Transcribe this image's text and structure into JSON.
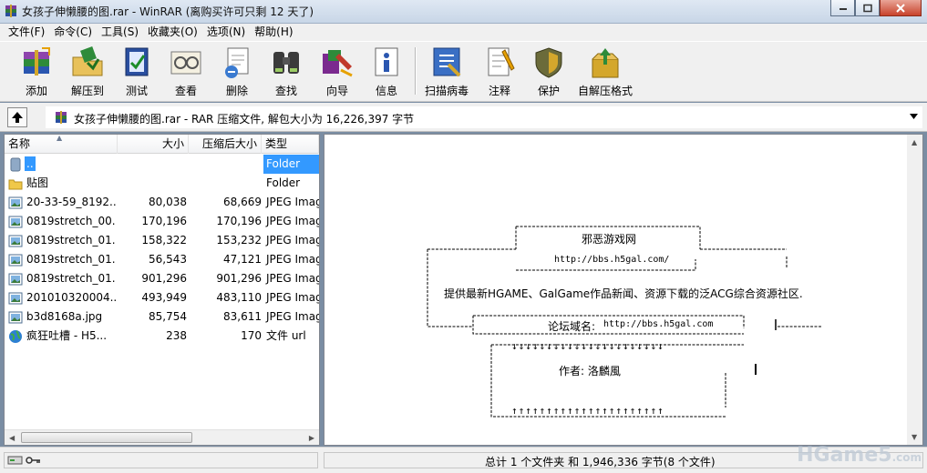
{
  "window": {
    "title": "女孩子伸懒腰的图.rar - WinRAR (离购买许可只剩 12 天了)"
  },
  "menu": [
    "文件(F)",
    "命令(C)",
    "工具(S)",
    "收藏夹(O)",
    "选项(N)",
    "帮助(H)"
  ],
  "toolbar": [
    {
      "label": "添加",
      "icon": "add-archive-icon"
    },
    {
      "label": "解压到",
      "icon": "extract-to-icon"
    },
    {
      "label": "测试",
      "icon": "test-icon"
    },
    {
      "label": "查看",
      "icon": "view-icon"
    },
    {
      "label": "删除",
      "icon": "delete-icon"
    },
    {
      "label": "查找",
      "icon": "find-icon"
    },
    {
      "label": "向导",
      "icon": "wizard-icon"
    },
    {
      "label": "信息",
      "icon": "info-icon"
    },
    {
      "label": "扫描病毒",
      "icon": "scan-virus-icon"
    },
    {
      "label": "注释",
      "icon": "comment-icon"
    },
    {
      "label": "保护",
      "icon": "protect-icon"
    },
    {
      "label": "自解压格式",
      "icon": "sfx-icon"
    }
  ],
  "address": {
    "text": "女孩子伸懒腰的图.rar - RAR 压缩文件, 解包大小为 16,226,397 字节"
  },
  "columns": {
    "name": "名称",
    "size": "大小",
    "packed": "压缩后大小",
    "type": "类型"
  },
  "files": [
    {
      "name": "..",
      "size": "",
      "packed": "",
      "type": "Folder",
      "icon": "parent-folder-icon"
    },
    {
      "name": "贴图",
      "size": "",
      "packed": "",
      "type": "Folder",
      "icon": "folder-icon"
    },
    {
      "name": "20-33-59_8192...",
      "size": "80,038",
      "packed": "68,669",
      "type": "JPEG Imag",
      "icon": "jpeg-file-icon"
    },
    {
      "name": "0819stretch_00...",
      "size": "170,196",
      "packed": "170,196",
      "type": "JPEG Imag",
      "icon": "jpeg-file-icon"
    },
    {
      "name": "0819stretch_01...",
      "size": "158,322",
      "packed": "153,232",
      "type": "JPEG Imag",
      "icon": "jpeg-file-icon"
    },
    {
      "name": "0819stretch_01...",
      "size": "56,543",
      "packed": "47,121",
      "type": "JPEG Imag",
      "icon": "jpeg-file-icon"
    },
    {
      "name": "0819stretch_01...",
      "size": "901,296",
      "packed": "901,296",
      "type": "JPEG Imag",
      "icon": "jpeg-file-icon"
    },
    {
      "name": "201010320004...",
      "size": "493,949",
      "packed": "483,110",
      "type": "JPEG Imag",
      "icon": "jpeg-file-icon"
    },
    {
      "name": "b3d8168a.jpg",
      "size": "85,754",
      "packed": "83,611",
      "type": "JPEG Imag",
      "icon": "jpeg-file-icon"
    },
    {
      "name": "疯狂吐槽 - H5...",
      "size": "238",
      "packed": "170",
      "type": "文件 url",
      "icon": "url-file-icon"
    }
  ],
  "comment": {
    "line1": "邪恶游戏网",
    "line2": "http://bbs.h5gal.com/",
    "line3": "提供最新HGAME、GalGame作品新闻、资源下载的泛ACG综合资源社区.",
    "line4_label": "论坛域名:",
    "line4_url": "http://bbs.h5gal.com",
    "arrows_down": "↓↓↓↓↓↓↓↓↓↓↓↓↓↓↓↓↓↓↓↓↓↓",
    "line5": "作者:  洛麟風",
    "arrows_up": "↑↑↑↑↑↑↑↑↑↑↑↑↑↑↑↑↑↑↑↑↑↑"
  },
  "status": {
    "summary": "总计 1 个文件夹 和 1,946,336 字节(8 个文件)"
  },
  "watermark": {
    "main": "HGame5",
    "suffix": ".com"
  },
  "colors": {
    "selection": "#3399ff",
    "titlebar": "#c8d6e7",
    "close_button": "#c8422b"
  }
}
